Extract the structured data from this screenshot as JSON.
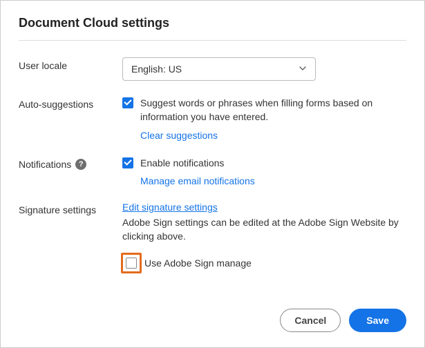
{
  "title": "Document Cloud settings",
  "userLocale": {
    "label": "User locale",
    "value": "English: US"
  },
  "autoSuggestions": {
    "label": "Auto-suggestions",
    "checkboxText": "Suggest words or phrases when filling forms based on information you have entered.",
    "clearLink": "Clear suggestions"
  },
  "notifications": {
    "label": "Notifications",
    "checkboxText": "Enable notifications",
    "manageLink": "Manage email notifications"
  },
  "signature": {
    "label": "Signature settings",
    "editLink": "Edit signature settings",
    "description": "Adobe Sign settings can be edited at the Adobe Sign Website by clicking above.",
    "manageCheckboxText": "Use Adobe Sign manage"
  },
  "buttons": {
    "cancel": "Cancel",
    "save": "Save"
  }
}
